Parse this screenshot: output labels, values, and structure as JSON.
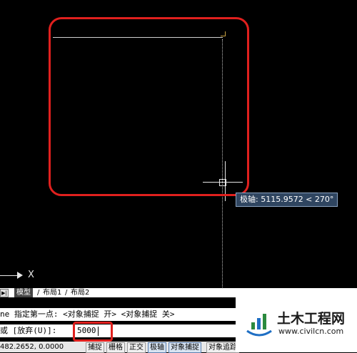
{
  "drawing": {
    "axis_label": "X",
    "tooltip": "极轴: 5115.9572 < 270°"
  },
  "tabs": {
    "nav": "▶|",
    "items": [
      "模型",
      "布局1",
      "布局2"
    ],
    "separator_1": "/",
    "separator_2": "/",
    "active": "模型"
  },
  "command": {
    "line1": "ne 指定第一点: <对象捕捉 开> <对象捕捉 关>",
    "line2_prompt": "或 [放弃(U)]:",
    "input_value": "5000"
  },
  "status": {
    "coordinates": "482.2652, 0.0000",
    "buttons": [
      "捕捉",
      "栅格",
      "正交",
      "极轴",
      "对象捕捉",
      "对象追踪"
    ]
  },
  "watermark": {
    "title": "土木工程网",
    "url": "www.civilcn.com"
  },
  "colors": {
    "highlight": "#e0201e",
    "tooltip_bg": "#2f4560"
  }
}
